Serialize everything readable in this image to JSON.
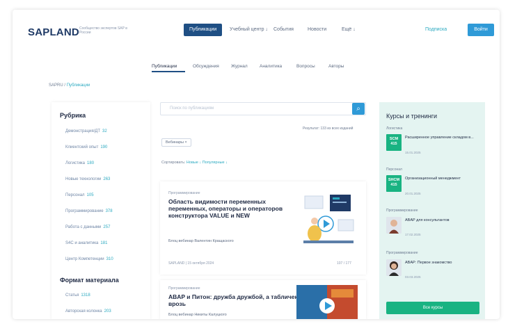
{
  "header": {
    "logo": "SAPLAND",
    "logo_tagline": "Сообщество экспертов SAP в России",
    "nav": [
      {
        "label": "Публикации"
      },
      {
        "label": "Учебный центр ↓"
      },
      {
        "label": "События"
      },
      {
        "label": "Новости"
      },
      {
        "label": "Ещё ↓"
      }
    ],
    "subscribe_label": "Подписка",
    "login_label": "Войти"
  },
  "subtabs": [
    "Публикации",
    "Обсуждения",
    "Журнал",
    "Аналитика",
    "Вопросы",
    "Авторы"
  ],
  "breadcrumb": {
    "root": "SAPRU",
    "sep": "/",
    "current": "Публикации"
  },
  "sidebar": {
    "rubric_title": "Рубрика",
    "categories": [
      {
        "label": "Демонстрация/ДТ",
        "count": "32"
      },
      {
        "label": "Клиентский опыт",
        "count": "190"
      },
      {
        "label": "Логистика",
        "count": "180"
      },
      {
        "label": "Новые технологии",
        "count": "263"
      },
      {
        "label": "Персонал",
        "count": "105"
      },
      {
        "label": "Программирование",
        "count": "378"
      },
      {
        "label": "Работа с данными",
        "count": "257"
      },
      {
        "label": "S4C и аналитика",
        "count": "181"
      },
      {
        "label": "Центр Компетенции",
        "count": "310"
      }
    ],
    "format_title": "Формат материала",
    "formats": [
      {
        "label": "Статья",
        "count": "1318"
      },
      {
        "label": "Авторская колонка",
        "count": "203"
      }
    ]
  },
  "search": {
    "placeholder": "Поиск по публикациям"
  },
  "results_text": "Результат: 133 из всех изданий",
  "filter_chip": "Вебинары ×",
  "sort": {
    "label": "Сортировать:",
    "by_date": "Новые ↓",
    "by_popular": "Популярные ↓"
  },
  "cards": [
    {
      "category": "Программирование",
      "title": "Область видимости переменных переменных, операторы и операторов конструктора VALUE и NEW",
      "author": "Блоц вебинар Валентин Кращаского",
      "meta": "SAPLAND | 15 октября 2024",
      "views": "107 / 177"
    },
    {
      "category": "Программирование",
      "title": "ABAP и Питон: дружба дружбой, а табличек врозь",
      "author": "Блоц вебинар Никиты Калуцкого",
      "meta": "",
      "views": ""
    }
  ],
  "courses": {
    "title": "Курсы и тренинги",
    "items": [
      {
        "category": "Логистика",
        "badge": "SCM",
        "badge_sub": "415",
        "text": "Расширенное управление складом в...",
        "date": "15.01.2025"
      },
      {
        "category": "Персонал",
        "badge": "SHCM",
        "badge_sub": "415",
        "text": "Организационный менеджмент",
        "date": "20.01.2025"
      },
      {
        "category": "Программирование",
        "avatar": "person-avatar",
        "text": "ABAP для консультантов",
        "date": "17.02.2025"
      },
      {
        "category": "Программирование",
        "avatar": "person-avatar",
        "text": "ABAP: Первое знакомство",
        "date": "03.03.2025"
      }
    ],
    "all_label": "Все курсы"
  },
  "colors": {
    "primary": "#1f4f84",
    "accent": "#2f9ad7",
    "green": "#19b382",
    "teal": "#2aa9c0",
    "panel": "#e4f4f1"
  }
}
